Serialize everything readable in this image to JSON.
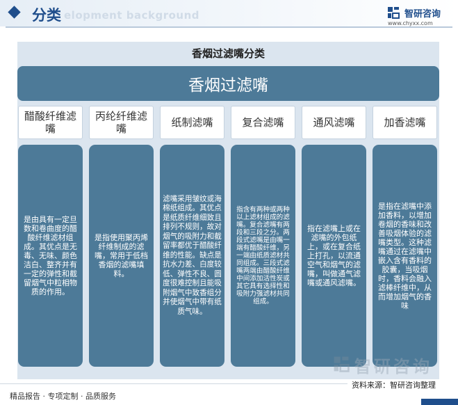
{
  "header": {
    "title": "分类",
    "watermark": "elopment background",
    "brand_name": "智研咨询",
    "brand_url": "www.chyxx.com"
  },
  "panel": {
    "title": "香烟过滤嘴分类",
    "root": "香烟过滤嘴",
    "categories": [
      {
        "name": "醋酸纤维滤嘴",
        "description": "是由具有一定旦数和卷曲度的醋酸纤维滤材组成。其优点是无毒、无味、颜色洁白、整齐并有一定的弹性和截留烟气中粒相物质的作用。"
      },
      {
        "name": "丙纶纤维滤嘴",
        "description": "是指使用聚丙烯纤维制成的滤嘴，常用于低档香烟的滤嘴填料。"
      },
      {
        "name": "纸制滤嘴",
        "description": "滤嘴采用皱纹或海棉纸组成。其优点是纸质纤维细致且排列不规则，故对烟气的吸附力和截留率都优于醋酸纤维的性能。缺点是抗水力差、白度较低、弹性不良、圆度很难控制且能吸附烟气中致香组分并使烟气中带有纸质气味。"
      },
      {
        "name": "复合滤嘴",
        "description": "指含有两种或两种以上滤材组成的滤嘴。复合滤嘴有两段和三段之分。两段式滤嘴是由嘴一端有醋酸纤维，另一端由纸质滤材共同组成。三段式滤嘴两端由醋酸纤维中间添加活性炭或其它具有选择性和吸附力强滤材共同组成。"
      },
      {
        "name": "通风滤嘴",
        "description": "指在滤嘴上或在滤嘴的外包纸上，或在复合纸上打孔，以流通空气和烟气的滤嘴，叫做通气滤嘴或通风滤嘴。"
      },
      {
        "name": "加香滤嘴",
        "description": "是指在滤嘴中添加香料，以增加卷烟的香味和改善吸烟体验的滤嘴类型。这种滤嘴通过在滤嘴中嵌入含有香料的胶囊，当吸烟时，香料会融入滤棒纤维中，从而增加烟气的香味"
      }
    ]
  },
  "footer": {
    "watermark": "智研咨询",
    "source": "资料来源：智研咨询整理",
    "left_text": "精品报告 · 专项定制 · 品质服务"
  },
  "colors": {
    "brand_blue": "#1f4e8c",
    "node_fill": "#4d7a98",
    "panel_fill": "#dbe5ef"
  }
}
